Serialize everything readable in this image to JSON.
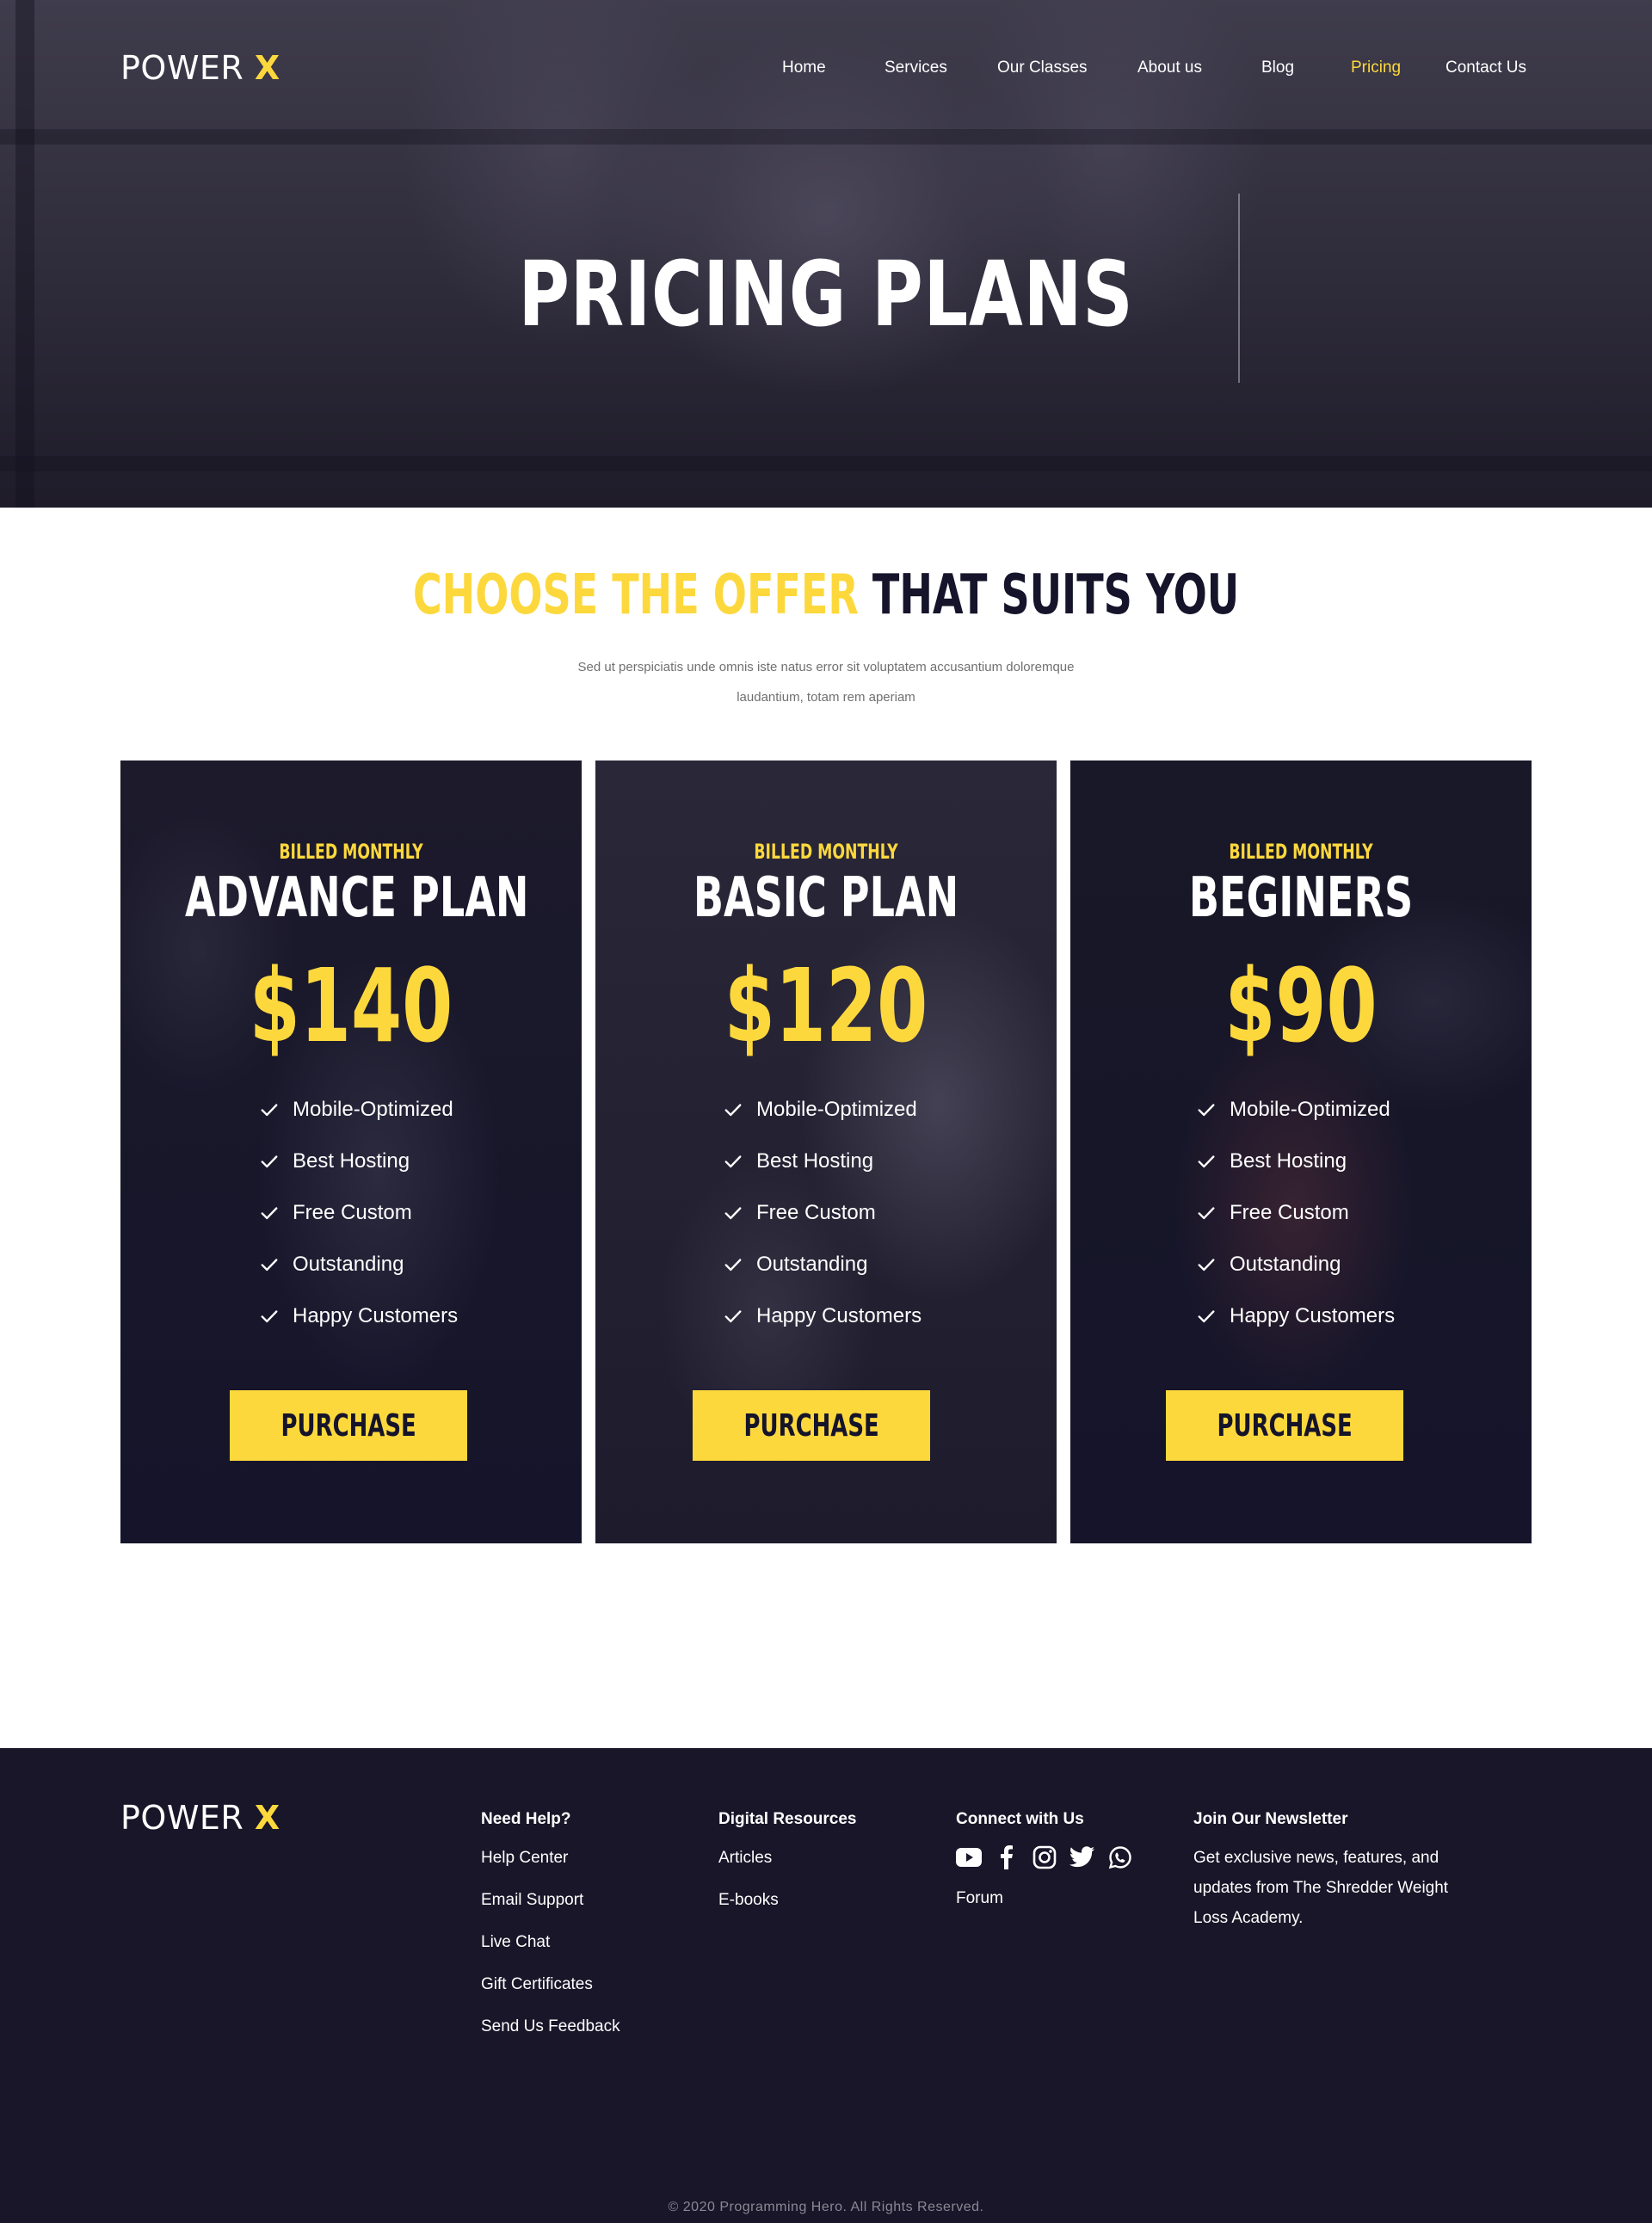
{
  "brand": {
    "name": "POWER",
    "accent_letter": "X"
  },
  "nav": {
    "items": [
      {
        "label": "Home"
      },
      {
        "label": "Services"
      },
      {
        "label": "Our Classes"
      },
      {
        "label": "About us"
      },
      {
        "label": "Blog"
      },
      {
        "label": "Pricing",
        "active": true
      },
      {
        "label": "Contact Us"
      }
    ]
  },
  "hero": {
    "title": "PRICING PLANS"
  },
  "section": {
    "title_highlight": "CHOOSE THE OFFER",
    "title_rest": "THAT SUITS YOU",
    "description": "Sed ut perspiciatis unde omnis iste natus error sit voluptatem accusantium doloremque laudantium, totam rem aperiam"
  },
  "plans": [
    {
      "billing": "BILLED MONTHLY",
      "name": "ADVANCE PLAN",
      "price": "$140",
      "features": [
        "Mobile-Optimized",
        "Best Hosting",
        "Free Custom",
        "Outstanding",
        "Happy Customers"
      ],
      "button_label": "PURCHASE"
    },
    {
      "billing": "BILLED MONTHLY",
      "name": "BASIC PLAN",
      "price": "$120",
      "features": [
        "Mobile-Optimized",
        "Best Hosting",
        "Free Custom",
        "Outstanding",
        "Happy Customers"
      ],
      "button_label": "PURCHASE"
    },
    {
      "billing": "BILLED MONTHLY",
      "name": "BEGINERS",
      "price": "$90",
      "features": [
        "Mobile-Optimized",
        "Best Hosting",
        "Free Custom",
        "Outstanding",
        "Happy Customers"
      ],
      "button_label": "PURCHASE"
    }
  ],
  "footer": {
    "need_help": {
      "heading": "Need Help?",
      "links": [
        "Help Center",
        "Email Support",
        "Live Chat",
        "Gift Certificates",
        "Send Us Feedback"
      ]
    },
    "digital_resources": {
      "heading": "Digital Resources",
      "links": [
        "Articles",
        "E-books"
      ]
    },
    "connect": {
      "heading": "Connect with Us",
      "social_icons": [
        "youtube-icon",
        "facebook-icon",
        "instagram-icon",
        "twitter-icon",
        "whatsapp-icon"
      ],
      "links": [
        "Forum"
      ]
    },
    "newsletter": {
      "heading": "Join Our Newsletter",
      "text": "Get exclusive news, features, and updates from The Shredder Weight Loss Academy."
    },
    "copyright": "© 2020 Programming Hero. All Rights Reserved."
  },
  "colors": {
    "accent": "#fdd83d",
    "dark": "#15142a",
    "footer_bg": "#181628",
    "muted_text": "#707070"
  }
}
